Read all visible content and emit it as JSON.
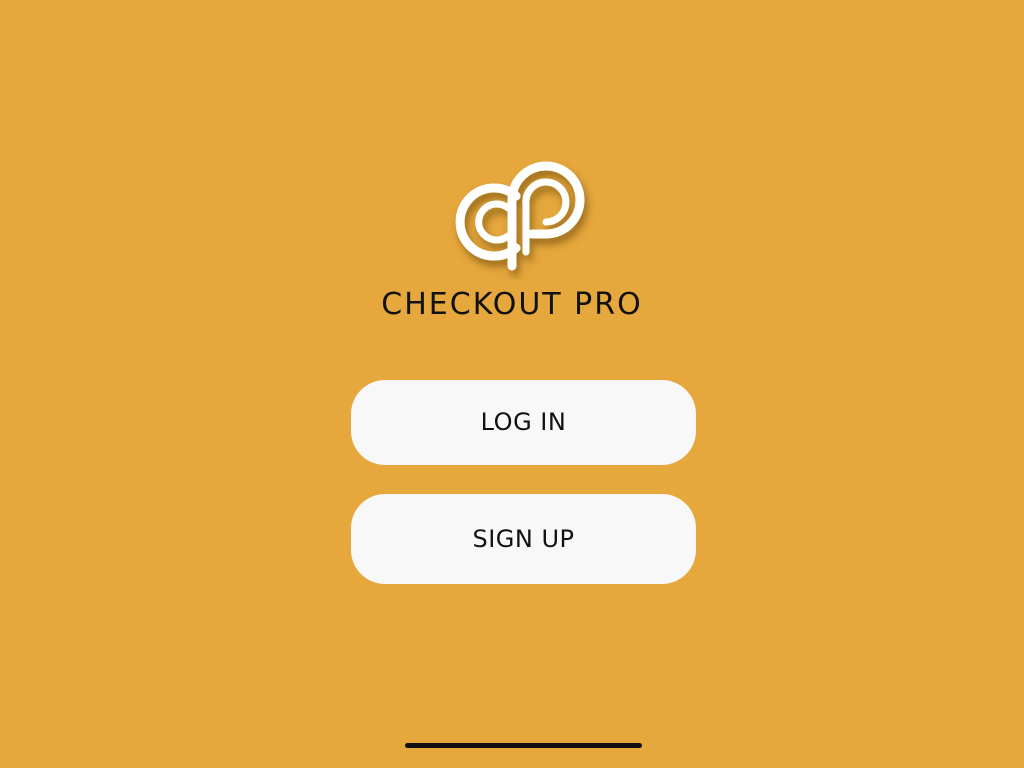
{
  "app": {
    "title": "CHECKOUT PRO",
    "logo_icon": "checkout-pro-cp-logo"
  },
  "actions": {
    "login_label": "LOG IN",
    "signup_label": "SIGN UP"
  },
  "colors": {
    "background": "#E6A73C",
    "button_background": "#F8F8F8",
    "text": "#111111",
    "logo": "#FFFFFF"
  }
}
